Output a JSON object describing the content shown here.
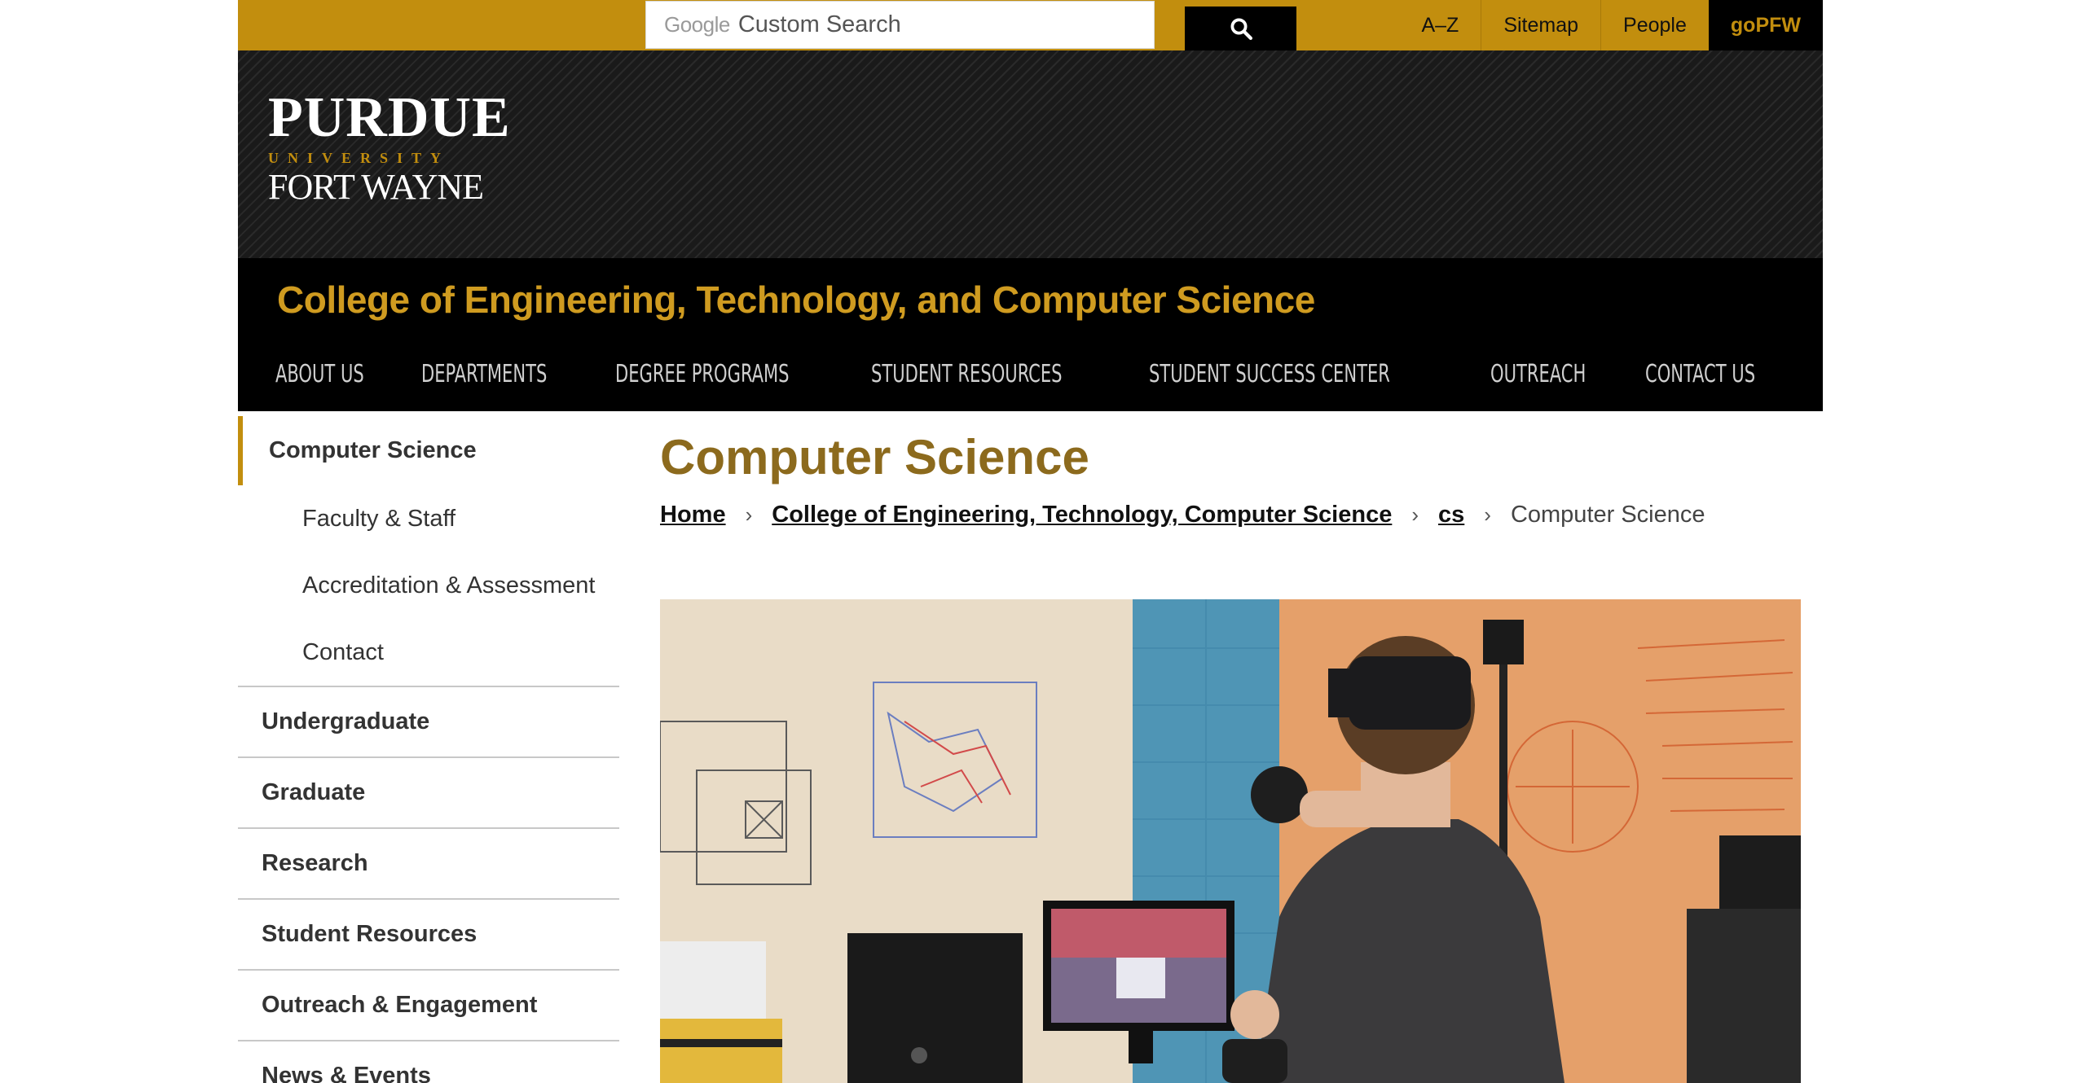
{
  "topbar": {
    "search": {
      "brand": "Google",
      "placeholder": "Custom Search"
    },
    "links": [
      "A–Z",
      "Sitemap",
      "People"
    ],
    "gopfw": "goPFW"
  },
  "logo": {
    "line1": "PURDUE",
    "line2": "UNIVERSITY",
    "line3": "FORT WAYNE"
  },
  "college": {
    "title": "College of Engineering, Technology, and Computer Science"
  },
  "mainnav": [
    "ABOUT US",
    "DEPARTMENTS",
    "DEGREE PROGRAMS",
    "STUDENT RESOURCES",
    "STUDENT SUCCESS CENTER",
    "OUTREACH",
    "CONTACT US"
  ],
  "sidebar": {
    "active": "Computer Science",
    "sub": [
      "Faculty & Staff",
      "Accreditation & Assessment",
      "Contact"
    ],
    "items": [
      "Undergraduate",
      "Graduate",
      "Research",
      "Student Resources",
      "Outreach & Engagement",
      "News & Events"
    ]
  },
  "main": {
    "title": "Computer Science",
    "breadcrumb": {
      "links": [
        "Home",
        "College of Engineering, Technology, Computer Science",
        "cs"
      ],
      "current": "Computer Science"
    }
  },
  "colors": {
    "gold": "#c28e0e",
    "title_gold": "#8c6a1d",
    "black": "#000000"
  }
}
